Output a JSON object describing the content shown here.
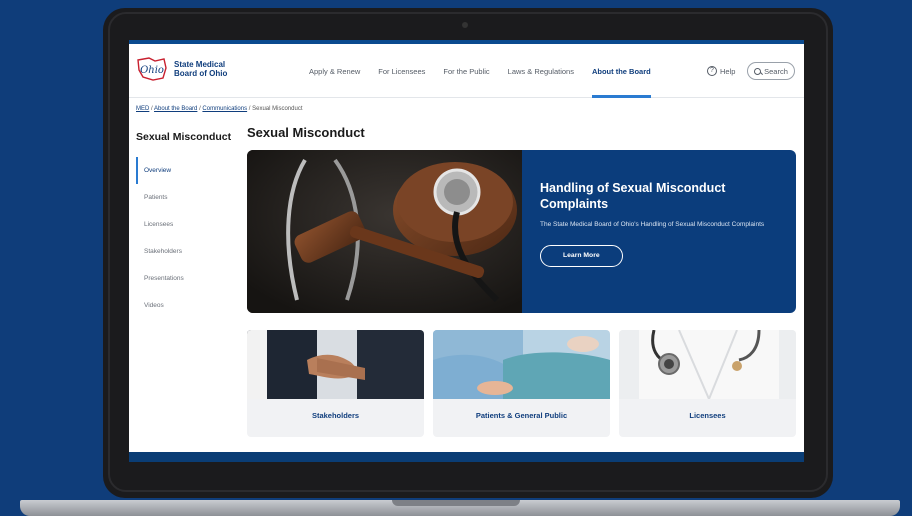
{
  "site": {
    "logo_script": "Ohio",
    "logo_line1": "State Medical",
    "logo_line2": "Board of Ohio"
  },
  "nav": {
    "items": [
      {
        "label": "Apply & Renew",
        "active": false
      },
      {
        "label": "For Licensees",
        "active": false
      },
      {
        "label": "For the Public",
        "active": false
      },
      {
        "label": "Laws & Regulations",
        "active": false
      },
      {
        "label": "About the Board",
        "active": true
      }
    ],
    "help_label": "Help",
    "search_label": "Search"
  },
  "breadcrumb": {
    "items": [
      "MED",
      "About the Board",
      "Communications"
    ],
    "current": "Sexual Misconduct",
    "separator": "/"
  },
  "sidebar": {
    "title": "Sexual Misconduct",
    "items": [
      {
        "label": "Overview",
        "active": true
      },
      {
        "label": "Patients",
        "active": false
      },
      {
        "label": "Licensees",
        "active": false
      },
      {
        "label": "Stakeholders",
        "active": false
      },
      {
        "label": "Presentations",
        "active": false
      },
      {
        "label": "Videos",
        "active": false
      }
    ]
  },
  "main": {
    "page_title": "Sexual Misconduct",
    "hero": {
      "title": "Handling of Sexual Misconduct Complaints",
      "description": "The State Medical Board of Ohio's Handling of Sexual Misconduct Complaints",
      "button_label": "Learn More"
    },
    "cards": [
      {
        "label": "Stakeholders",
        "image": "handshake-photo"
      },
      {
        "label": "Patients & General Public",
        "image": "patient-photo"
      },
      {
        "label": "Licensees",
        "image": "doctor-stethoscope-photo"
      }
    ]
  },
  "colors": {
    "background": "#0f3d7a",
    "brand_navy": "#103e7d",
    "hero_panel": "#0b3d7c",
    "accent_blue": "#2a7bd1"
  }
}
